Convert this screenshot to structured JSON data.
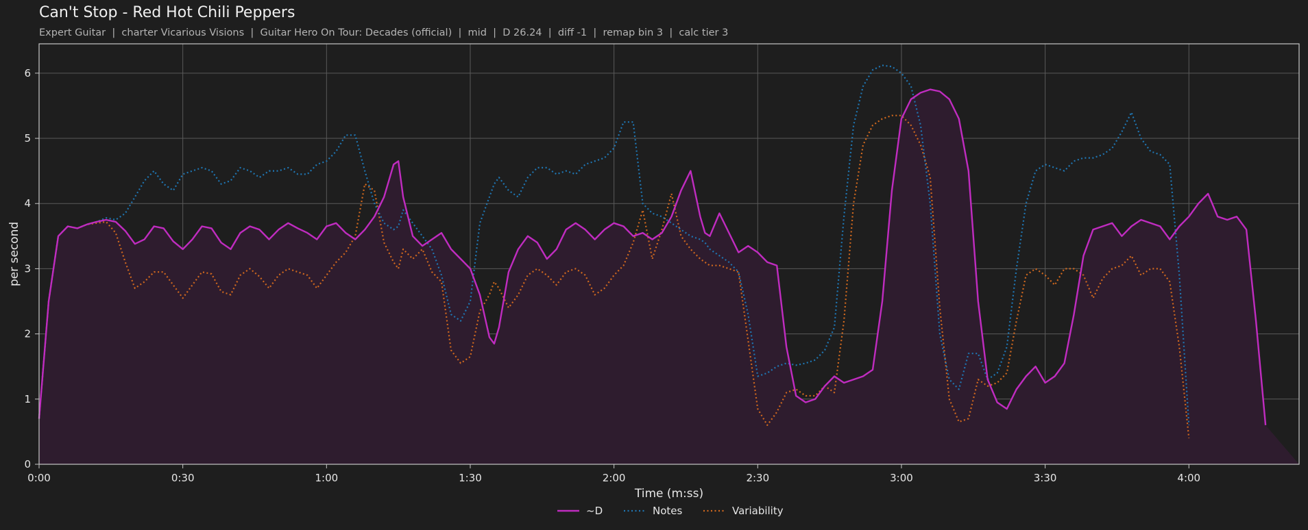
{
  "header": {
    "title": "Can't Stop - Red Hot Chili Peppers",
    "subtitle": "Expert Guitar  |  charter Vicarious Visions  |  Guitar Hero On Tour: Decades (official)  |  mid  |  D 26.24  |  diff -1  |  remap bin 3  |  calc tier 3"
  },
  "colors": {
    "background": "#1e1e1e",
    "plot_border": "#c8c8c8",
    "grid": "#5a5a5a",
    "d_line": "#c02cc0",
    "d_fill": "#2e1c2e",
    "notes": "#1f77b4",
    "variability": "#d2691e"
  },
  "chart_data": {
    "type": "line",
    "xlabel": "Time (m:ss)",
    "ylabel": "per second",
    "xlim": [
      0,
      263
    ],
    "ylim": [
      0,
      6.45
    ],
    "grid": true,
    "legend_position": "bottom-center",
    "x_ticks": [
      0,
      30,
      60,
      90,
      120,
      150,
      180,
      210,
      240
    ],
    "x_tick_labels": [
      "0:00",
      "0:30",
      "1:00",
      "1:30",
      "2:00",
      "2:30",
      "3:00",
      "3:30",
      "4:00"
    ],
    "y_ticks": [
      0,
      1,
      2,
      3,
      4,
      5,
      6
    ],
    "y_tick_labels": [
      "0",
      "1",
      "2",
      "3",
      "4",
      "5",
      "6"
    ],
    "x": [
      0,
      2,
      4,
      6,
      8,
      10,
      12,
      14,
      16,
      18,
      20,
      22,
      24,
      26,
      28,
      30,
      32,
      34,
      36,
      38,
      40,
      42,
      44,
      46,
      48,
      50,
      52,
      54,
      56,
      58,
      60,
      62,
      64,
      66,
      68,
      70,
      72,
      74,
      75,
      76,
      78,
      80,
      82,
      84,
      86,
      88,
      90,
      92,
      94,
      95,
      96,
      98,
      100,
      102,
      104,
      106,
      108,
      110,
      112,
      114,
      116,
      118,
      120,
      122,
      124,
      126,
      128,
      130,
      132,
      134,
      136,
      138,
      139,
      140,
      142,
      144,
      146,
      148,
      150,
      152,
      154,
      156,
      158,
      160,
      162,
      164,
      166,
      168,
      170,
      172,
      174,
      176,
      178,
      180,
      182,
      184,
      186,
      188,
      190,
      192,
      194,
      196,
      198,
      200,
      202,
      204,
      206,
      208,
      210,
      212,
      214,
      216,
      218,
      220,
      222,
      224,
      226,
      228,
      230,
      232,
      234,
      236,
      238,
      240,
      242,
      244,
      246,
      248,
      250,
      252,
      254,
      256,
      258,
      260,
      262,
      263
    ],
    "series": [
      {
        "name": "~D",
        "style": "solid",
        "values": [
          0.7,
          2.5,
          3.5,
          3.65,
          3.62,
          3.68,
          3.72,
          3.75,
          3.72,
          3.58,
          3.38,
          3.45,
          3.65,
          3.62,
          3.42,
          3.3,
          3.45,
          3.65,
          3.62,
          3.4,
          3.3,
          3.55,
          3.65,
          3.6,
          3.45,
          3.6,
          3.7,
          3.62,
          3.55,
          3.45,
          3.65,
          3.7,
          3.55,
          3.45,
          3.6,
          3.8,
          4.1,
          4.6,
          4.65,
          4.1,
          3.5,
          3.35,
          3.45,
          3.55,
          3.3,
          3.15,
          3.0,
          2.6,
          1.95,
          1.85,
          2.1,
          2.95,
          3.3,
          3.5,
          3.4,
          3.15,
          3.3,
          3.6,
          3.7,
          3.6,
          3.45,
          3.6,
          3.7,
          3.65,
          3.5,
          3.55,
          3.45,
          3.55,
          3.8,
          4.2,
          4.5,
          3.8,
          3.55,
          3.5,
          3.85,
          3.55,
          3.25,
          3.35,
          3.25,
          3.1,
          3.05,
          1.8,
          1.05,
          0.95,
          1.0,
          1.2,
          1.35,
          1.25,
          1.3,
          1.35,
          1.45,
          2.5,
          4.2,
          5.3,
          5.6,
          5.7,
          5.75,
          5.72,
          5.6,
          5.3,
          4.5,
          2.5,
          1.3,
          0.95,
          0.85,
          1.15,
          1.35,
          1.5,
          1.25,
          1.35,
          1.55,
          2.3,
          3.2,
          3.6,
          3.65,
          3.7,
          3.5,
          3.65,
          3.75,
          3.7,
          3.65,
          3.45,
          3.65,
          3.8,
          4.0,
          4.15,
          3.8,
          3.75,
          3.8,
          3.6,
          2.2,
          0.6
        ]
      },
      {
        "name": "Notes",
        "style": "dotted",
        "values": [
          0.7,
          2.5,
          3.5,
          3.65,
          3.62,
          3.68,
          3.72,
          3.78,
          3.75,
          3.85,
          4.1,
          4.35,
          4.5,
          4.3,
          4.2,
          4.45,
          4.5,
          4.55,
          4.5,
          4.3,
          4.35,
          4.55,
          4.5,
          4.4,
          4.5,
          4.5,
          4.55,
          4.45,
          4.45,
          4.6,
          4.65,
          4.8,
          5.05,
          5.05,
          4.5,
          4.0,
          3.7,
          3.6,
          3.65,
          3.9,
          3.7,
          3.5,
          3.3,
          2.9,
          2.3,
          2.2,
          2.5,
          3.7,
          4.1,
          4.3,
          4.4,
          4.2,
          4.1,
          4.4,
          4.55,
          4.55,
          4.45,
          4.5,
          4.45,
          4.6,
          4.65,
          4.7,
          4.85,
          5.25,
          5.25,
          4.0,
          3.85,
          3.8,
          3.7,
          3.6,
          3.5,
          3.45,
          3.4,
          3.3,
          3.2,
          3.1,
          2.95,
          2.3,
          1.35,
          1.4,
          1.5,
          1.55,
          1.52,
          1.55,
          1.6,
          1.75,
          2.1,
          3.8,
          5.2,
          5.8,
          6.05,
          6.12,
          6.1,
          6.0,
          5.8,
          5.2,
          4.0,
          2.0,
          1.3,
          1.15,
          1.7,
          1.7,
          1.3,
          1.4,
          1.8,
          3.0,
          4.0,
          4.5,
          4.6,
          4.55,
          4.5,
          4.65,
          4.7,
          4.7,
          4.75,
          4.85,
          5.1,
          5.4,
          5.0,
          4.8,
          4.75,
          4.6,
          2.9,
          0.6
        ]
      },
      {
        "name": "Variability",
        "style": "dotted",
        "values": [
          0.7,
          2.5,
          3.5,
          3.65,
          3.62,
          3.68,
          3.7,
          3.72,
          3.55,
          3.1,
          2.7,
          2.8,
          2.95,
          2.95,
          2.75,
          2.55,
          2.75,
          2.95,
          2.92,
          2.65,
          2.6,
          2.9,
          3.0,
          2.88,
          2.7,
          2.9,
          3.0,
          2.95,
          2.9,
          2.7,
          2.9,
          3.1,
          3.25,
          3.5,
          4.3,
          4.2,
          3.4,
          3.1,
          3.0,
          3.3,
          3.15,
          3.3,
          2.95,
          2.8,
          1.75,
          1.55,
          1.65,
          2.35,
          2.6,
          2.8,
          2.7,
          2.4,
          2.6,
          2.9,
          3.0,
          2.9,
          2.75,
          2.95,
          3.0,
          2.9,
          2.6,
          2.7,
          2.9,
          3.05,
          3.4,
          3.9,
          3.15,
          3.6,
          4.15,
          3.5,
          3.3,
          3.15,
          3.1,
          3.05,
          3.05,
          3.0,
          2.95,
          1.9,
          0.85,
          0.6,
          0.8,
          1.1,
          1.15,
          1.05,
          1.05,
          1.2,
          1.1,
          2.2,
          4.0,
          4.9,
          5.2,
          5.3,
          5.35,
          5.35,
          5.2,
          4.9,
          4.4,
          2.4,
          1.0,
          0.65,
          0.7,
          1.3,
          1.2,
          1.25,
          1.4,
          2.2,
          2.9,
          3.0,
          2.9,
          2.75,
          3.0,
          3.0,
          2.9,
          2.55,
          2.85,
          3.0,
          3.05,
          3.2,
          2.9,
          3.0,
          3.0,
          2.8,
          1.8,
          0.4
        ]
      }
    ]
  }
}
